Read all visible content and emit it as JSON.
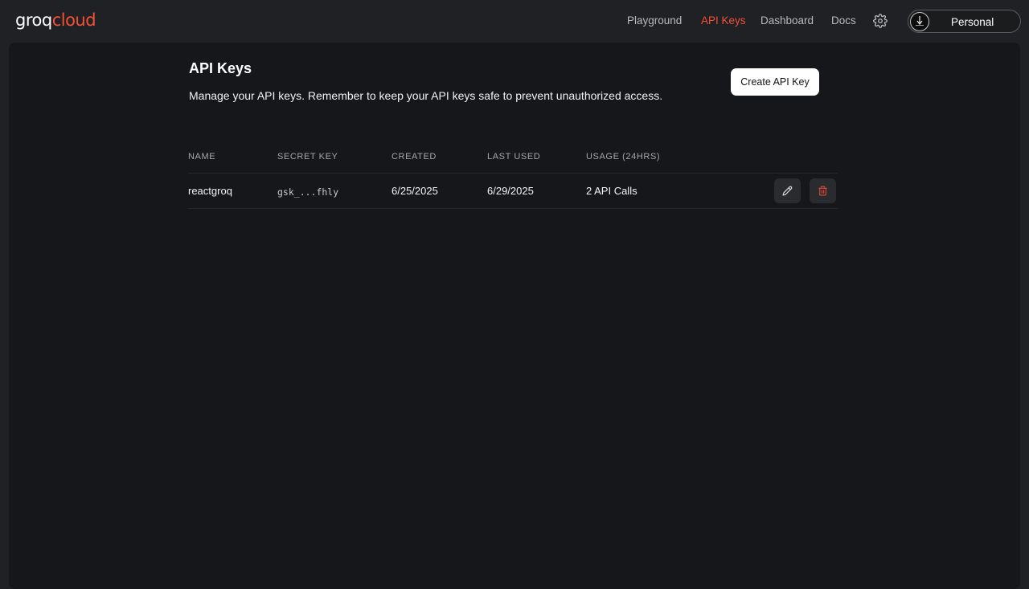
{
  "header": {
    "logo": {
      "part1": "groq",
      "part2": "cloud"
    },
    "nav": [
      {
        "label": "Playground",
        "active": false
      },
      {
        "label": "API Keys",
        "active": true
      },
      {
        "label": "Dashboard",
        "active": false
      },
      {
        "label": "Docs",
        "active": false
      }
    ],
    "settings_icon": "gear-icon",
    "account": {
      "label": "Personal",
      "avatar_icon": "avatar-icon"
    }
  },
  "main": {
    "title": "API Keys",
    "description": "Manage your API keys. Remember to keep your API keys safe to prevent unauthorized access.",
    "create_button": "Create API Key",
    "table": {
      "columns": [
        "NAME",
        "SECRET KEY",
        "CREATED",
        "LAST USED",
        "USAGE (24HRS)"
      ],
      "rows": [
        {
          "name": "reactgroq",
          "secret_key": "gsk_...fhly",
          "created": "6/25/2025",
          "last_used": "6/29/2025",
          "usage": "2 API Calls",
          "actions": [
            "edit-icon",
            "trash-icon"
          ]
        }
      ]
    }
  },
  "colors": {
    "accent": "#f55036",
    "background": "#202124",
    "panel": "#16171a",
    "delete": "#e5483a"
  }
}
